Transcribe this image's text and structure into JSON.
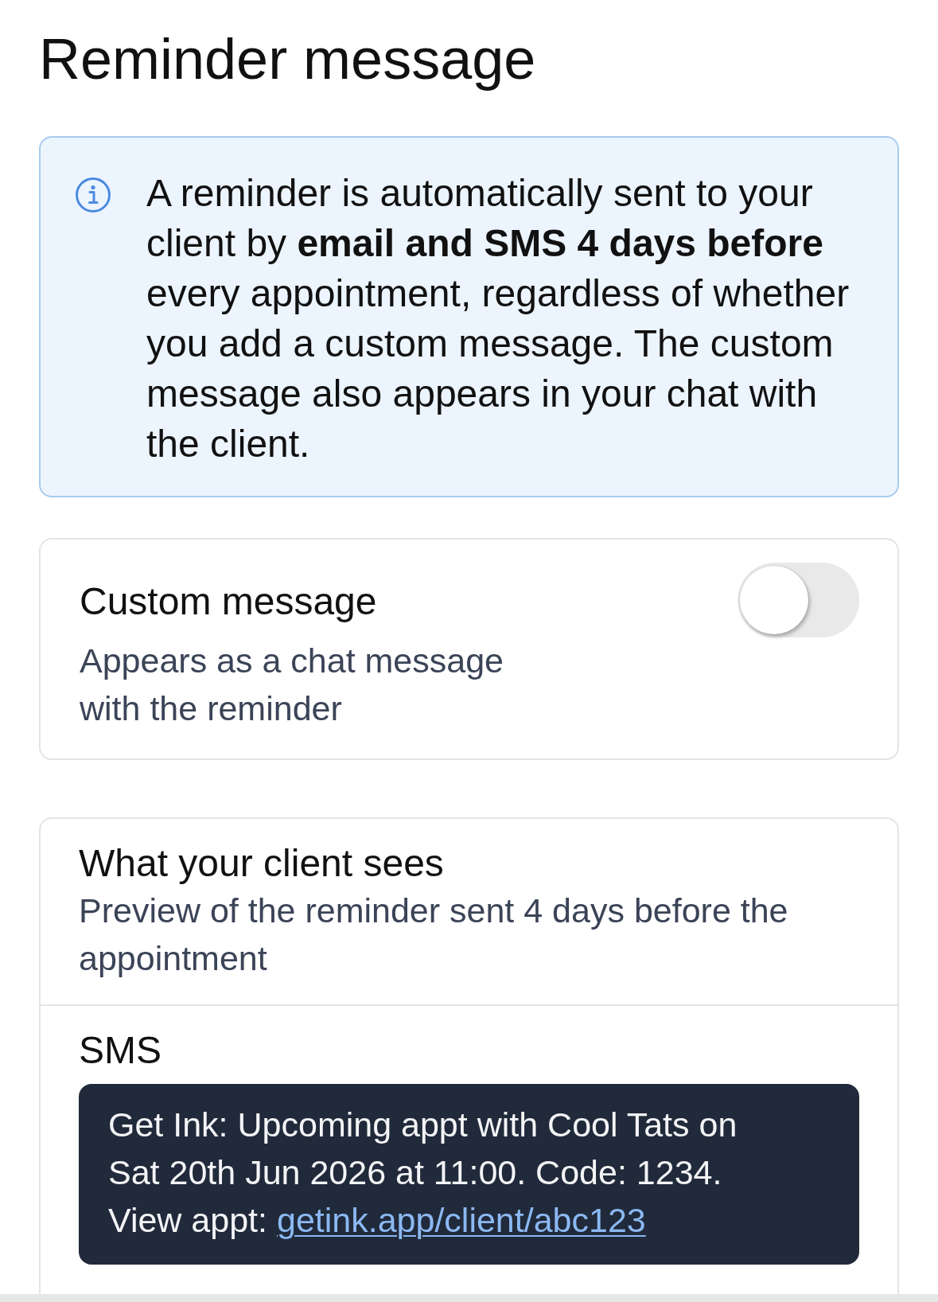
{
  "title": "Reminder message",
  "info": {
    "text": "A reminder is automatically sent to your client by **email and SMS 4 days before** every appointment, regardless of whether you add a custom message. The custom message also appears in your chat with the client."
  },
  "custom_message": {
    "title": "Custom message",
    "description": "Appears as a chat message with the reminder",
    "on": false
  },
  "preview": {
    "title": "What your client sees",
    "description": "Preview of the reminder sent 4 days before the appointment",
    "channel": "SMS",
    "message": {
      "text": "Get Ink: Upcoming appt with Cool Tats on Sat 20th Jun 2026 at 11:00. Code: 1234. View appt:",
      "link": "getink.app/client/abc123"
    }
  }
}
